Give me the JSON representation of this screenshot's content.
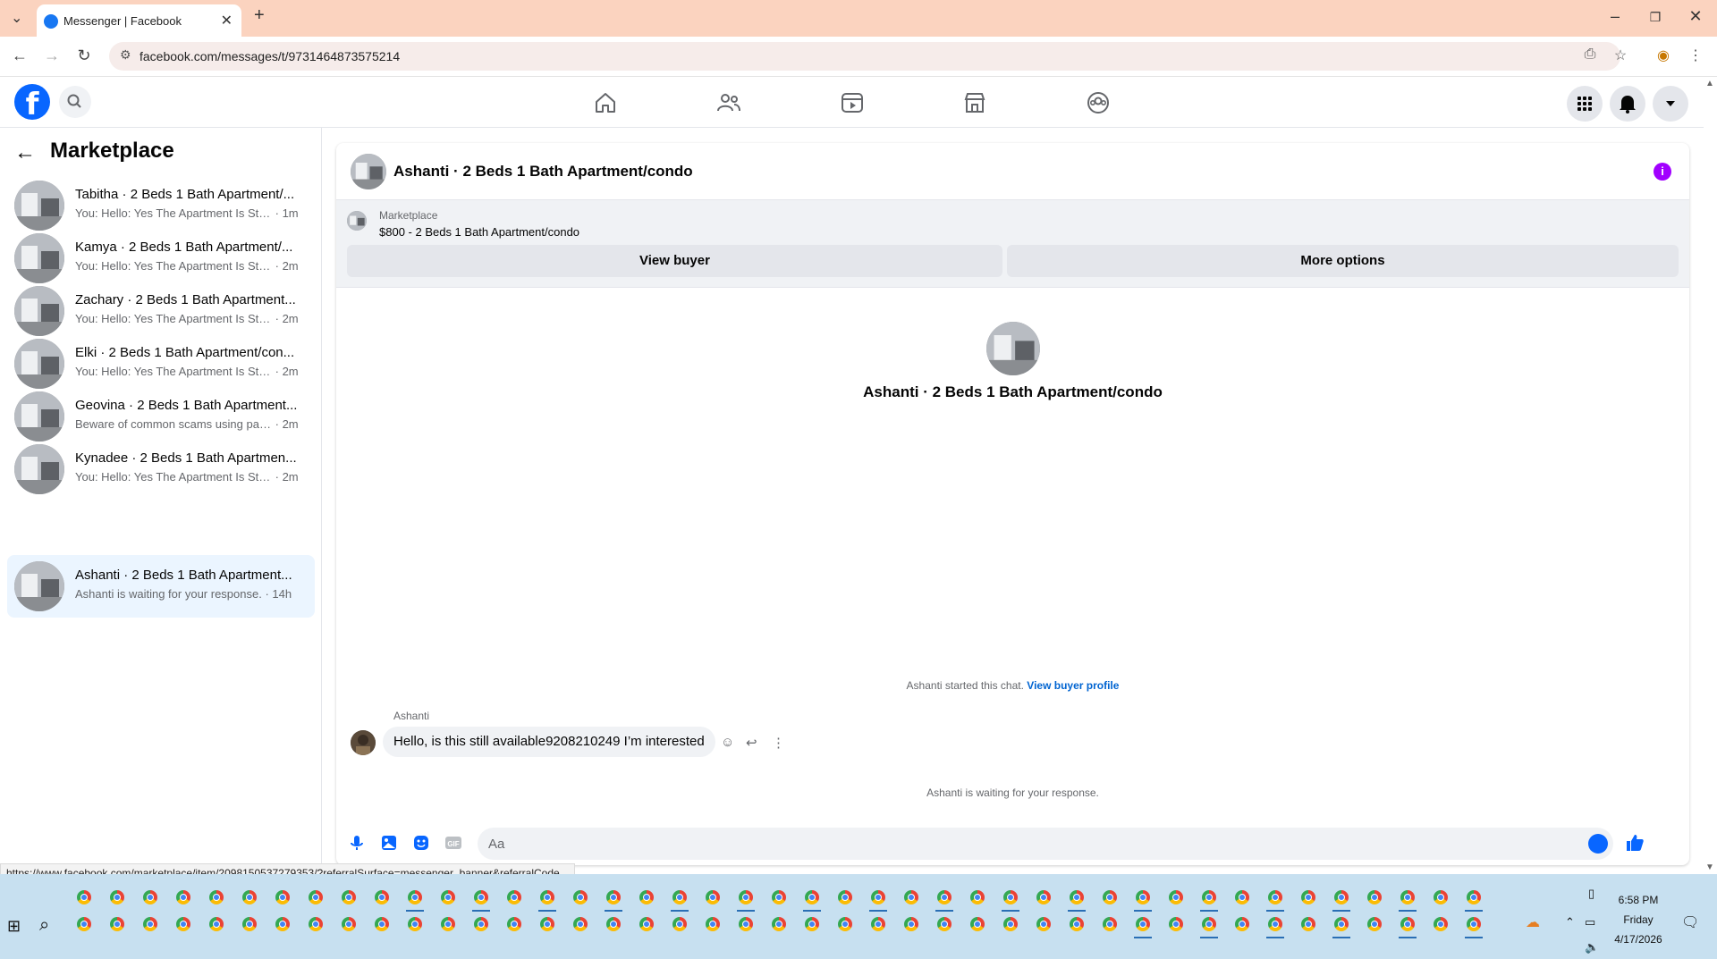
{
  "browser": {
    "tab_title": "Messenger | Facebook",
    "url": "facebook.com/messages/t/9731464873575214",
    "status_url": "https://www.facebook.com/marketplace/item/2098150537279353/?referralSurface=messenger_banner&referralCode..."
  },
  "sidebar": {
    "title": "Marketplace",
    "conversations": [
      {
        "name": "Tabitha · 2 Beds 1 Bath Apartment/...",
        "snippet": "You: Hello: Yes The Apartment Is Still ...",
        "time": "· 1m"
      },
      {
        "name": "Kamya · 2 Beds 1 Bath Apartment/...",
        "snippet": "You: Hello: Yes The Apartment Is Still ...",
        "time": "· 2m"
      },
      {
        "name": "Zachary · 2 Beds 1 Bath Apartment...",
        "snippet": "You: Hello: Yes The Apartment Is Still ...",
        "time": "· 2m"
      },
      {
        "name": "Elki · 2 Beds 1 Bath Apartment/con...",
        "snippet": "You: Hello: Yes The Apartment Is Still ...",
        "time": "· 2m"
      },
      {
        "name": "Geovina · 2 Beds 1 Bath Apartment...",
        "snippet": "Beware of common scams using pay...",
        "time": "· 2m"
      },
      {
        "name": "Kynadee · 2 Beds 1 Bath Apartmen...",
        "snippet": "You: Hello: Yes The Apartment Is Still ...",
        "time": "· 2m"
      },
      {
        "name": "Ashanti · 2 Beds 1 Bath Apartment...",
        "snippet": "Ashanti is waiting for your response.",
        "time": "· 14h"
      }
    ]
  },
  "chat": {
    "title": "Ashanti · 2 Beds 1 Bath Apartment/condo",
    "banner": {
      "label": "Marketplace",
      "item": "$800 - 2 Beds 1 Bath Apartment/condo",
      "view_buyer": "View buyer",
      "more_options": "More options"
    },
    "intro_title": "Ashanti · 2 Beds 1 Bath Apartment/condo",
    "started_text": "Ashanti started this chat.",
    "view_profile": "View buyer profile",
    "sender": "Ashanti",
    "message": "Hello, is this still available9208210249 I’m interested",
    "waiting": "Ashanti is waiting for your response.",
    "composer_placeholder": "Aa"
  },
  "taskbar": {
    "time": "6:58 PM",
    "day": "Friday",
    "date": "4/17/2026"
  },
  "colors": {
    "tab_strip": "#fbd3bf",
    "fb_blue": "#0866ff",
    "info_purple": "#a100ff",
    "active_row": "#ebf5ff",
    "taskbar": "#c7e0f0"
  }
}
